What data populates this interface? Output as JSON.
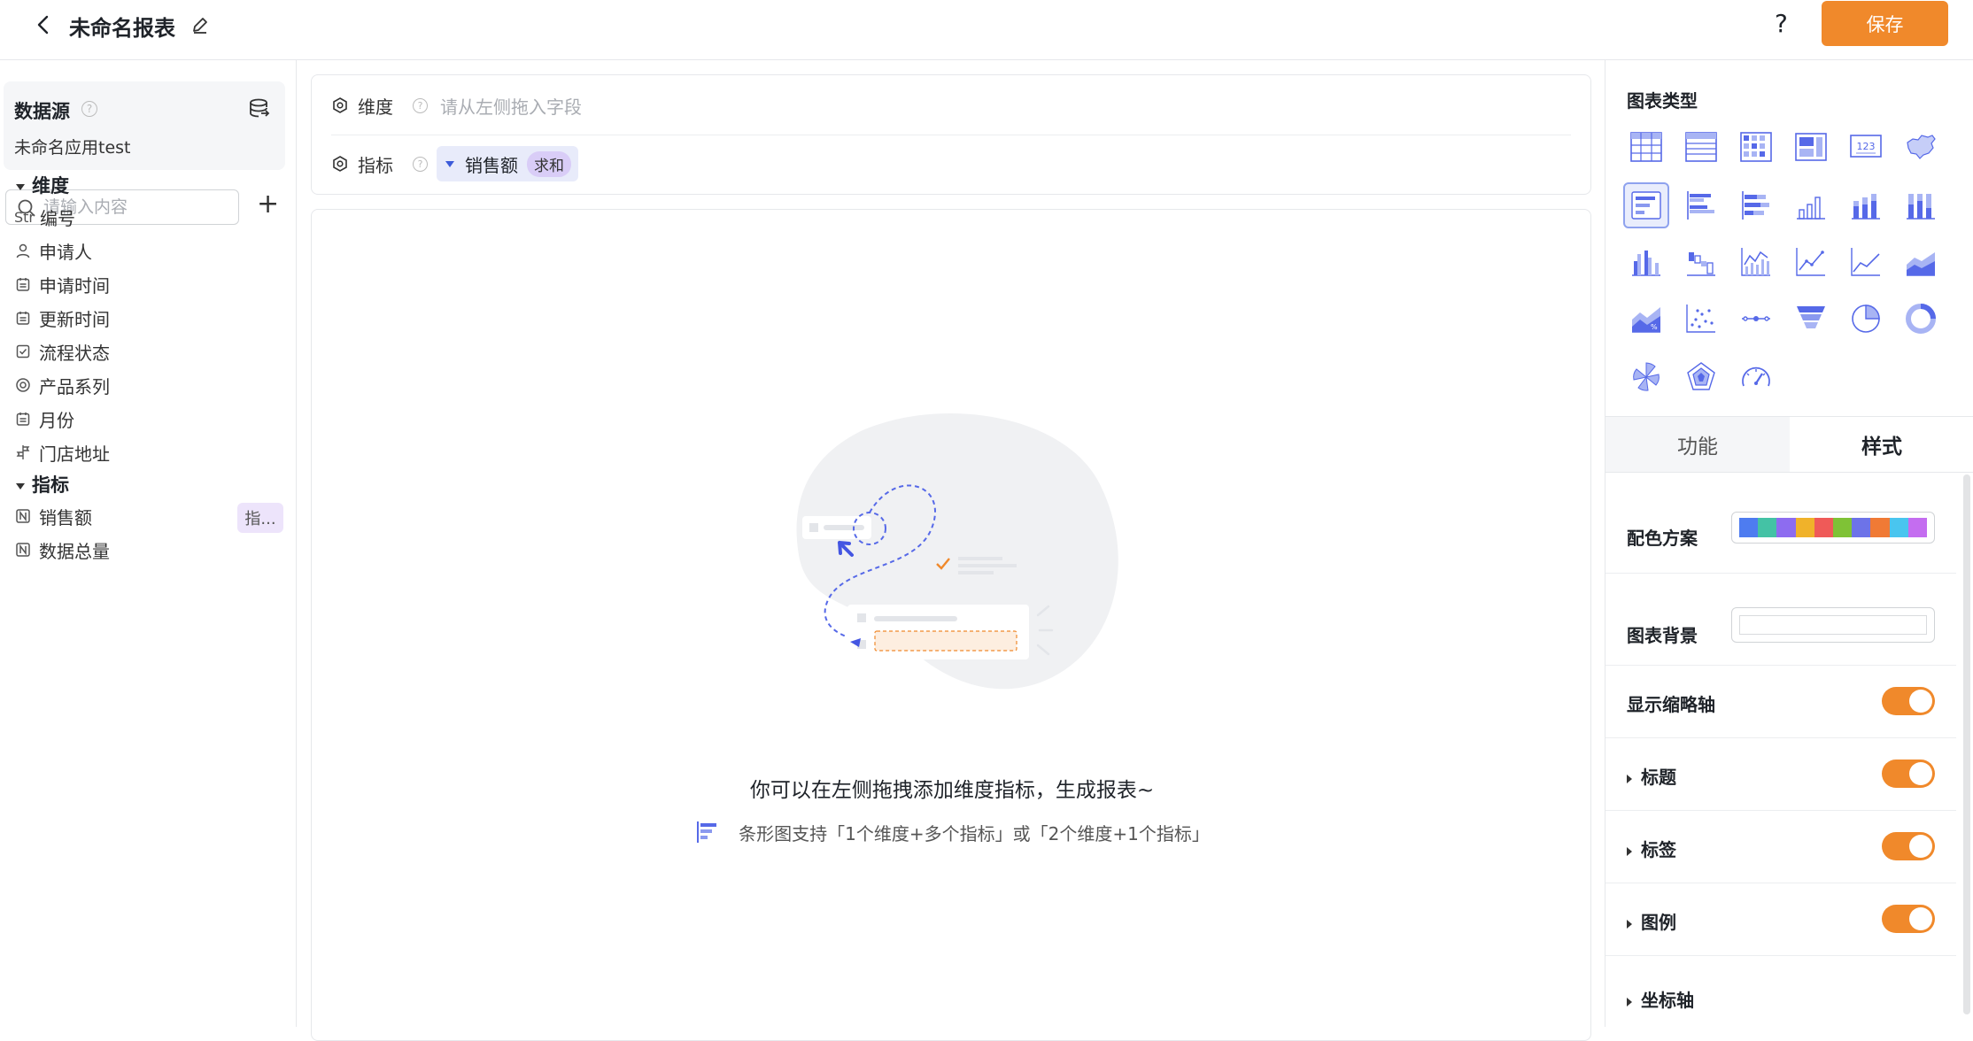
{
  "header": {
    "title": "未命名报表",
    "help_label": "?",
    "save_label": "保存"
  },
  "datasource": {
    "title": "数据源",
    "help": "?",
    "name": "未命名应用test"
  },
  "search": {
    "placeholder": "请输入内容",
    "add_label": "+"
  },
  "dimensions": {
    "title": "维度",
    "items": [
      {
        "type_label": "Str",
        "label": "编号",
        "icon": "string-icon"
      },
      {
        "label": "申请人",
        "icon": "person-icon"
      },
      {
        "label": "申请时间",
        "icon": "calendar-icon"
      },
      {
        "label": "更新时间",
        "icon": "calendar-icon"
      },
      {
        "label": "流程状态",
        "icon": "checkbox-icon"
      },
      {
        "label": "产品系列",
        "icon": "radio-icon"
      },
      {
        "label": "月份",
        "icon": "calendar-icon"
      },
      {
        "label": "门店地址",
        "icon": "location-icon"
      }
    ]
  },
  "metrics": {
    "title": "指标",
    "items": [
      {
        "label": "销售额",
        "icon": "number-icon",
        "tag": "指..."
      },
      {
        "label": "数据总量",
        "icon": "number-icon"
      }
    ]
  },
  "shelf": {
    "dimension_label": "维度",
    "dimension_placeholder": "请从左侧拖入字段",
    "metric_label": "指标",
    "help": "?",
    "metric_chip": {
      "name": "销售额",
      "aggregation": "求和"
    }
  },
  "canvas": {
    "empty_text": "你可以在左侧拖拽添加维度指标，生成报表~",
    "hint": "条形图支持「1个维度+多个指标」或「2个维度+1个指标」"
  },
  "chart_types": {
    "title": "图表类型",
    "selected": "bar-horizontal",
    "items": [
      "table",
      "detail-table",
      "cross-table",
      "cards",
      "kpi-number",
      "map",
      "bar-horizontal",
      "bar-grouped-horizontal",
      "bar-stacked-horizontal",
      "column",
      "column-stacked",
      "column-percent",
      "column-grouped",
      "waterfall",
      "combo-line-bar",
      "line",
      "area",
      "area-stacked",
      "area-percent",
      "scatter",
      "timeline",
      "funnel",
      "pie",
      "donut",
      "rose",
      "radar",
      "gauge"
    ]
  },
  "tabs": {
    "function": "功能",
    "style": "样式",
    "active": "style"
  },
  "style": {
    "color_scheme_label": "配色方案",
    "color_scheme": [
      "#4e7cf0",
      "#44c2a5",
      "#8d6cf0",
      "#f0b22a",
      "#ef5a58",
      "#7fc236",
      "#6d73e8",
      "#f07a35",
      "#49c5ef",
      "#c46df0"
    ],
    "background_label": "图表背景",
    "show_thumbnail_axis_label": "显示缩略轴",
    "show_thumbnail_axis": true,
    "title_label": "标题",
    "title_on": true,
    "label_label": "标签",
    "label_on": true,
    "legend_label": "图例",
    "legend_on": true,
    "axis_label": "坐标轴"
  },
  "colors": {
    "accent": "#f0892b",
    "primary": "#4e6ef2"
  }
}
